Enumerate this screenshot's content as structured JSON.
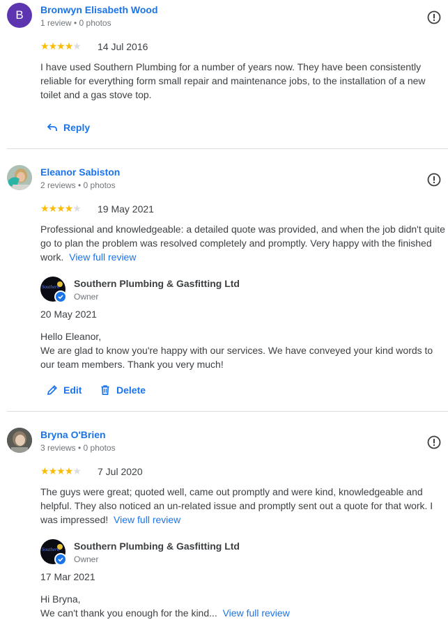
{
  "reviews": [
    {
      "author": "Bronwyn Elisabeth Wood",
      "avatar_letter": "B",
      "meta": "1 review • 0 photos",
      "rating": 4,
      "date": "14 Jul 2016",
      "text": "I have used Southern Plumbing for a number of years now. They have been consistently reliable for everything form small repair and maintenance jobs, to the installation of a new toilet and a gas stove top.",
      "actions": [
        "Reply"
      ]
    },
    {
      "author": "Eleanor Sabiston",
      "meta": "2 reviews • 0 photos",
      "rating": 4,
      "date": "19 May 2021",
      "text": "Professional and knowledgeable: a detailed quote was provided, and when the job didn't quite go to plan the problem was resolved completely and promptly. Very happy with the finished work.",
      "view_full": "View full review",
      "owner_reply": {
        "owner_name": "Southern Plumbing & Gasfitting Ltd",
        "owner_role": "Owner",
        "date": "20 May 2021",
        "greeting": "Hello Eleanor,",
        "body": "We are glad to know you're happy with our services. We have conveyed your kind words to our team members. Thank you very much!"
      },
      "actions": [
        "Edit",
        "Delete"
      ]
    },
    {
      "author": "Bryna O'Brien",
      "meta": "3 reviews • 0 photos",
      "rating": 4,
      "date": "7 Jul 2020",
      "text": "The guys were great; quoted well, came out promptly and were kind, knowledgeable and helpful. They also noticed an un-related issue and promptly sent out a quote for that work. I was impressed!",
      "view_full": "View full review",
      "owner_reply": {
        "owner_name": "Southern Plumbing & Gasfitting Ltd",
        "owner_role": "Owner",
        "date": "17 Mar 2021",
        "greeting": "Hi Bryna,",
        "body": "We can't thank you enough for the kind...",
        "view_full": "View full review"
      }
    }
  ],
  "owner_logo_text": "Southern",
  "colors": {
    "link": "#1a73e8",
    "star": "#fbbc04",
    "star_empty": "#dadce0",
    "avatar_b": "#5e35b1"
  }
}
